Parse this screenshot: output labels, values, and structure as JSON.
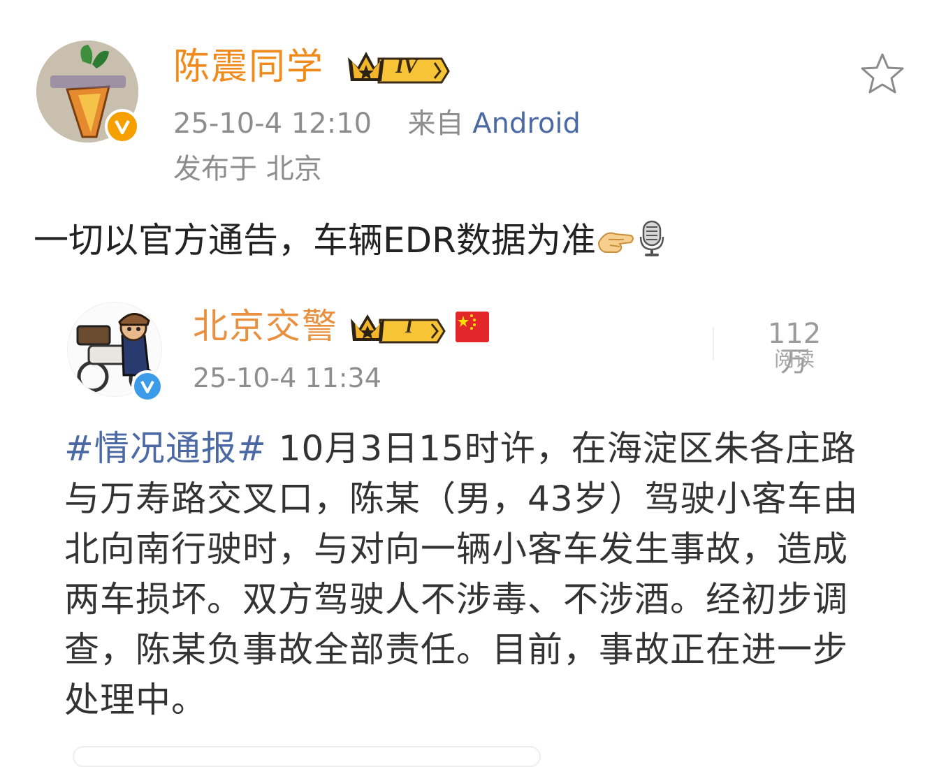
{
  "post": {
    "author": "陈震同学",
    "level_badge": "IV",
    "timestamp": "25-10-4 12:10",
    "source_prefix": "来自",
    "source": "Android",
    "location": "发布于 北京",
    "text": "一切以官方通告，车辆EDR数据为准",
    "emojis": [
      "handshake-emoji",
      "microphone-emoji"
    ]
  },
  "repost": {
    "author": "北京交警",
    "level_badge": "I",
    "flag": "china-flag",
    "timestamp": "25-10-4 11:34",
    "reads_count": "112万",
    "reads_label": "阅读",
    "topic": "#情况通报#",
    "body": " 10月3日15时许，在海淀区朱各庄路与万寿路交叉口，陈某（男，43岁）驾驶小客车由北向南行驶时，与对向一辆小客车发生事故，造成两车损坏。双方驾驶人不涉毒、不涉酒。经初步调查，陈某负事故全部责任。目前，事故正在进一步处理中。"
  },
  "colors": {
    "username": "#f08a1c",
    "link": "#4b6aa5",
    "meta": "#8d8d8d",
    "verified_gold": "#f6a000",
    "verified_blue": "#3b9be8"
  }
}
